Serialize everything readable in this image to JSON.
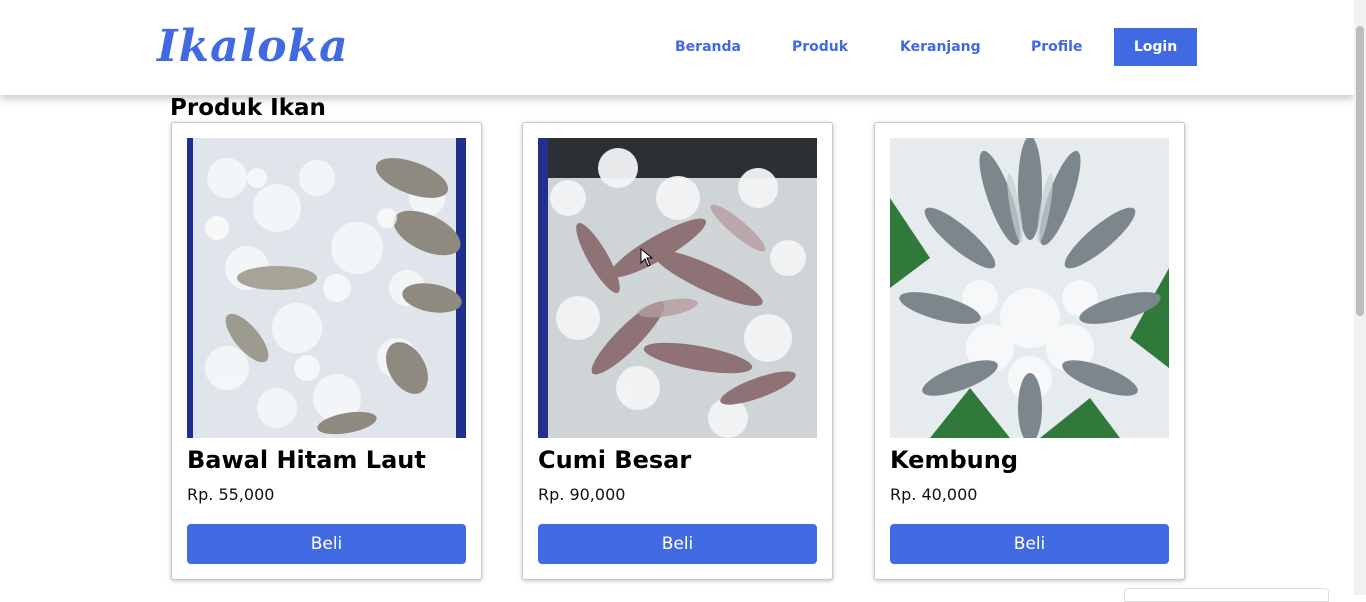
{
  "brand": {
    "name": "Ikaloka"
  },
  "nav": {
    "items": [
      {
        "label": "Beranda"
      },
      {
        "label": "Produk"
      },
      {
        "label": "Keranjang"
      },
      {
        "label": "Profile"
      }
    ],
    "login_label": "Login"
  },
  "colors": {
    "accent": "#4169e1",
    "background": "#ffffff"
  },
  "section": {
    "title": "Produk Ikan"
  },
  "products": [
    {
      "name": "Bawal Hitam Laut",
      "price": "Rp. 55,000",
      "buy_label": "Beli"
    },
    {
      "name": "Cumi Besar",
      "price": "Rp. 90,000",
      "buy_label": "Beli"
    },
    {
      "name": "Kembung",
      "price": "Rp. 40,000",
      "buy_label": "Beli"
    }
  ]
}
